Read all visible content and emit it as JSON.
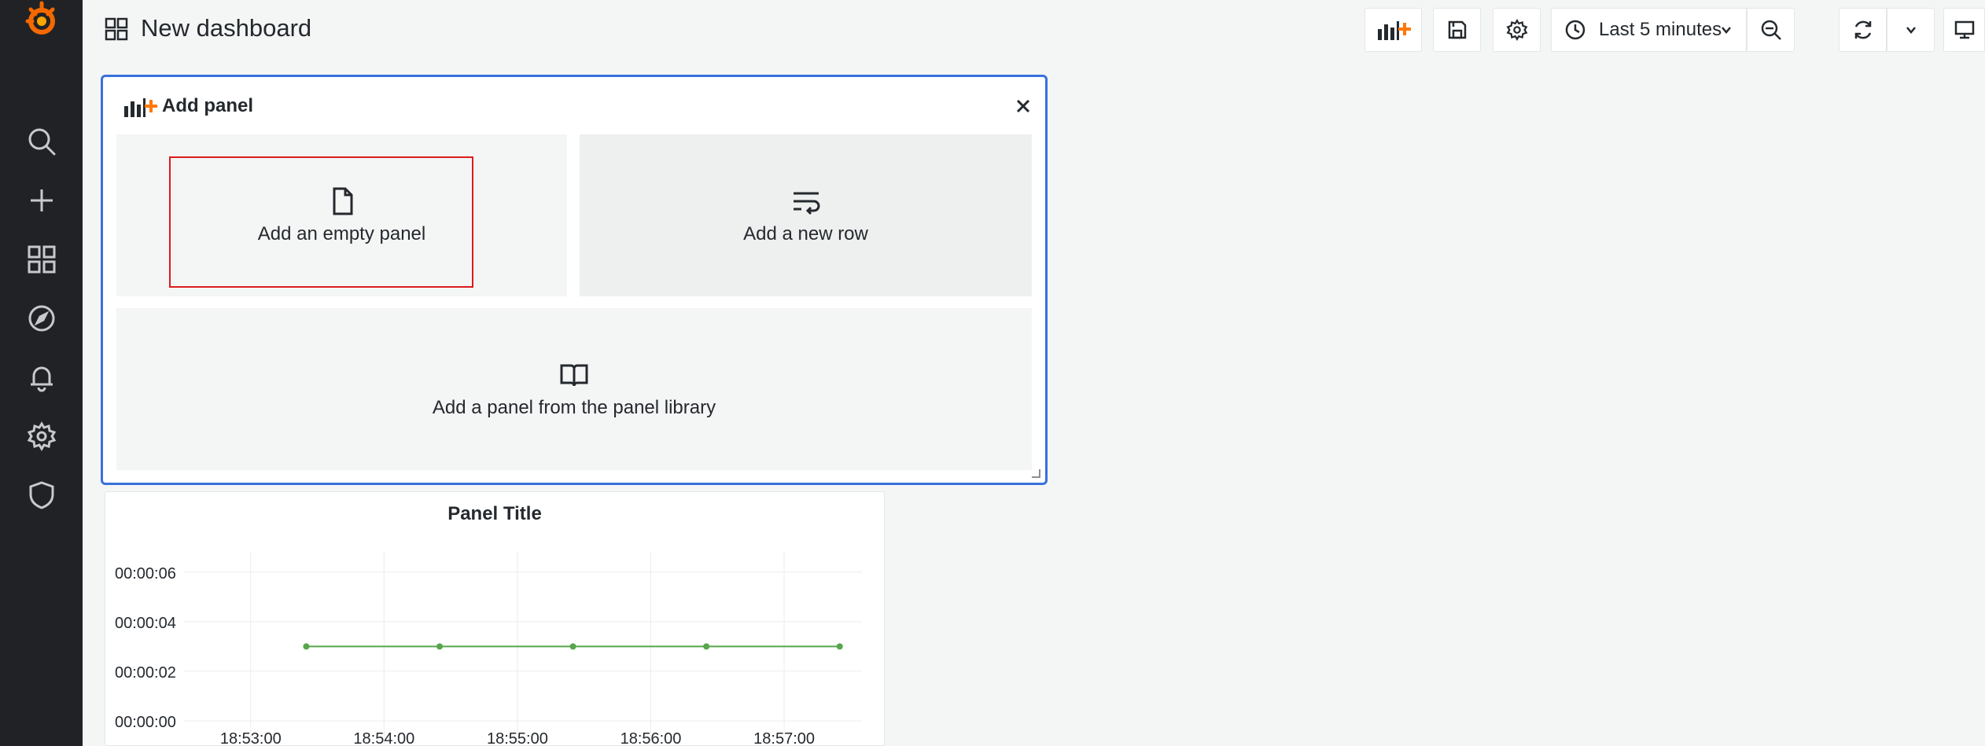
{
  "app": {
    "title": "New dashboard"
  },
  "colors": {
    "accent": "#3871dc",
    "highlight": "#dc1c1c",
    "sidebar_bg": "#202226",
    "series": "#56a64b",
    "logo": "#f46800"
  },
  "sidebar": {
    "items": [
      {
        "icon": "search-icon",
        "label": "Search"
      },
      {
        "icon": "plus-icon",
        "label": "Create"
      },
      {
        "icon": "dashboards-icon",
        "label": "Dashboards"
      },
      {
        "icon": "explore-icon",
        "label": "Explore"
      },
      {
        "icon": "bell-icon",
        "label": "Alerting"
      },
      {
        "icon": "gear-icon",
        "label": "Configuration"
      },
      {
        "icon": "shield-icon",
        "label": "Server Admin"
      }
    ]
  },
  "toolbar": {
    "time_range": "Last 5 minutes",
    "buttons": [
      "add-panel-icon",
      "save-icon",
      "gear-icon",
      "zoom-out-icon",
      "refresh-icon",
      "chevron-down-icon",
      "monitor-icon"
    ]
  },
  "add_panel": {
    "title": "Add panel",
    "options": {
      "empty_panel": "Add an empty panel",
      "new_row": "Add a new row",
      "library": "Add a panel from the panel library"
    }
  },
  "graph": {
    "title": "Panel Title"
  },
  "chart_data": {
    "type": "line",
    "title": "Panel Title",
    "xlabel": "",
    "ylabel": "",
    "y_ticks": [
      "00:00:00",
      "00:00:02",
      "00:00:04",
      "00:00:06"
    ],
    "x_ticks": [
      "18:53:00",
      "18:54:00",
      "18:55:00",
      "18:56:00",
      "18:57:00"
    ],
    "ylim": [
      0,
      6.5
    ],
    "xlim": [
      "18:52:30",
      "18:57:35"
    ],
    "series": [
      {
        "x": [
          "18:53:25",
          "18:54:25",
          "18:55:25",
          "18:56:25",
          "18:57:25"
        ],
        "values": [
          3,
          3,
          3,
          3,
          3
        ]
      }
    ],
    "grid": true,
    "legend": "none"
  }
}
